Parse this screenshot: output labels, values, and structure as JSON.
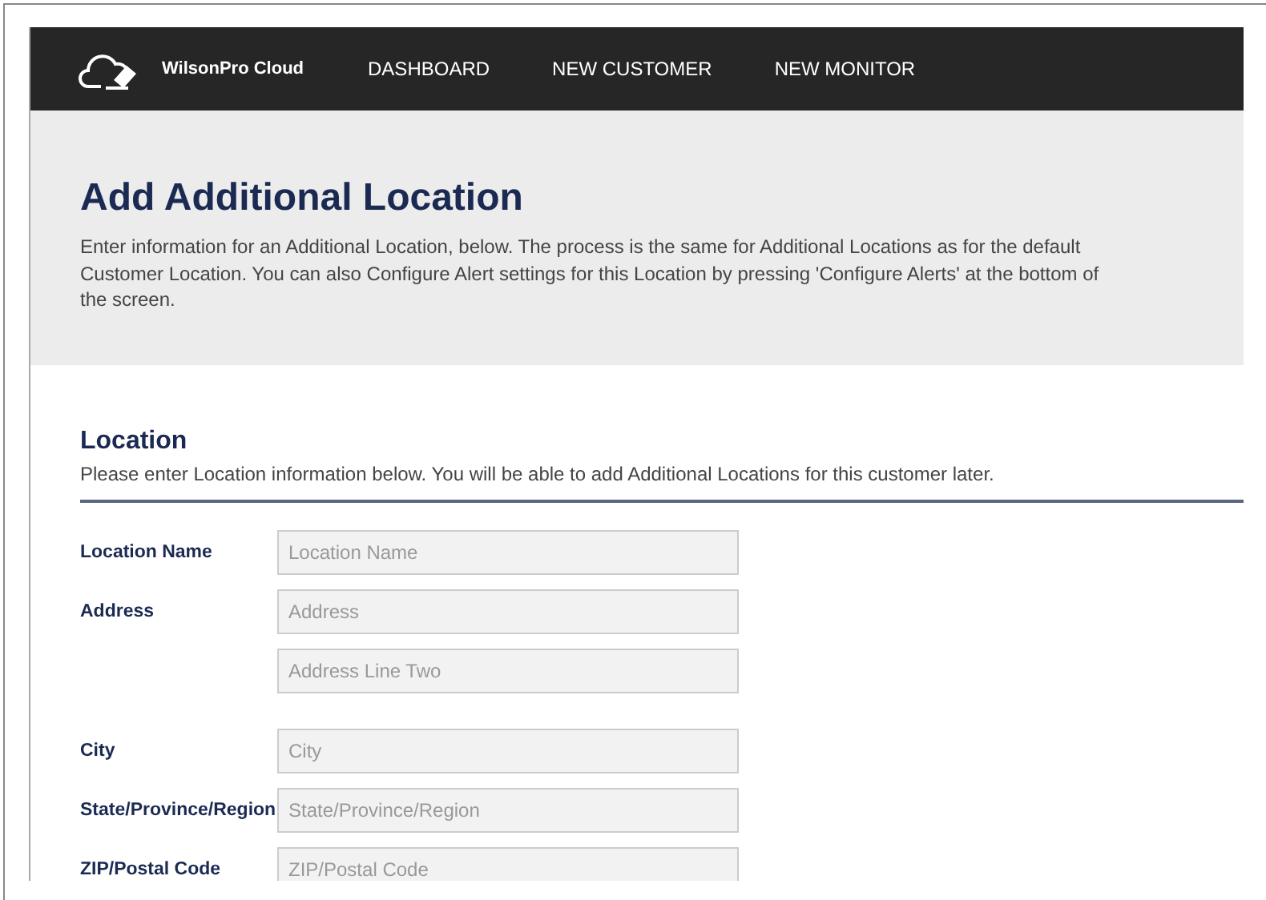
{
  "navbar": {
    "brand": "WilsonPro Cloud",
    "links": [
      {
        "label": "DASHBOARD"
      },
      {
        "label": "NEW CUSTOMER"
      },
      {
        "label": "NEW MONITOR"
      }
    ]
  },
  "header": {
    "title": "Add Additional Location",
    "description": "Enter information for an Additional Location, below. The process is the same for Additional Locations as for the default Customer Location. You can also Configure Alert settings for this Location by pressing 'Configure Alerts' at the bottom of the screen."
  },
  "section": {
    "title": "Location",
    "description": "Please enter Location information below. You will be able to add Additional Locations for this customer later.",
    "fields": [
      {
        "label": "Location Name",
        "placeholders": [
          "Location Name"
        ]
      },
      {
        "label": "Address",
        "placeholders": [
          "Address",
          "Address Line Two"
        ]
      },
      {
        "label": "City",
        "placeholders": [
          "City"
        ]
      },
      {
        "label": "State/Province/Region",
        "placeholders": [
          "State/Province/Region"
        ]
      },
      {
        "label": "ZIP/Postal Code",
        "placeholders": [
          "ZIP/Postal Code"
        ]
      }
    ]
  }
}
